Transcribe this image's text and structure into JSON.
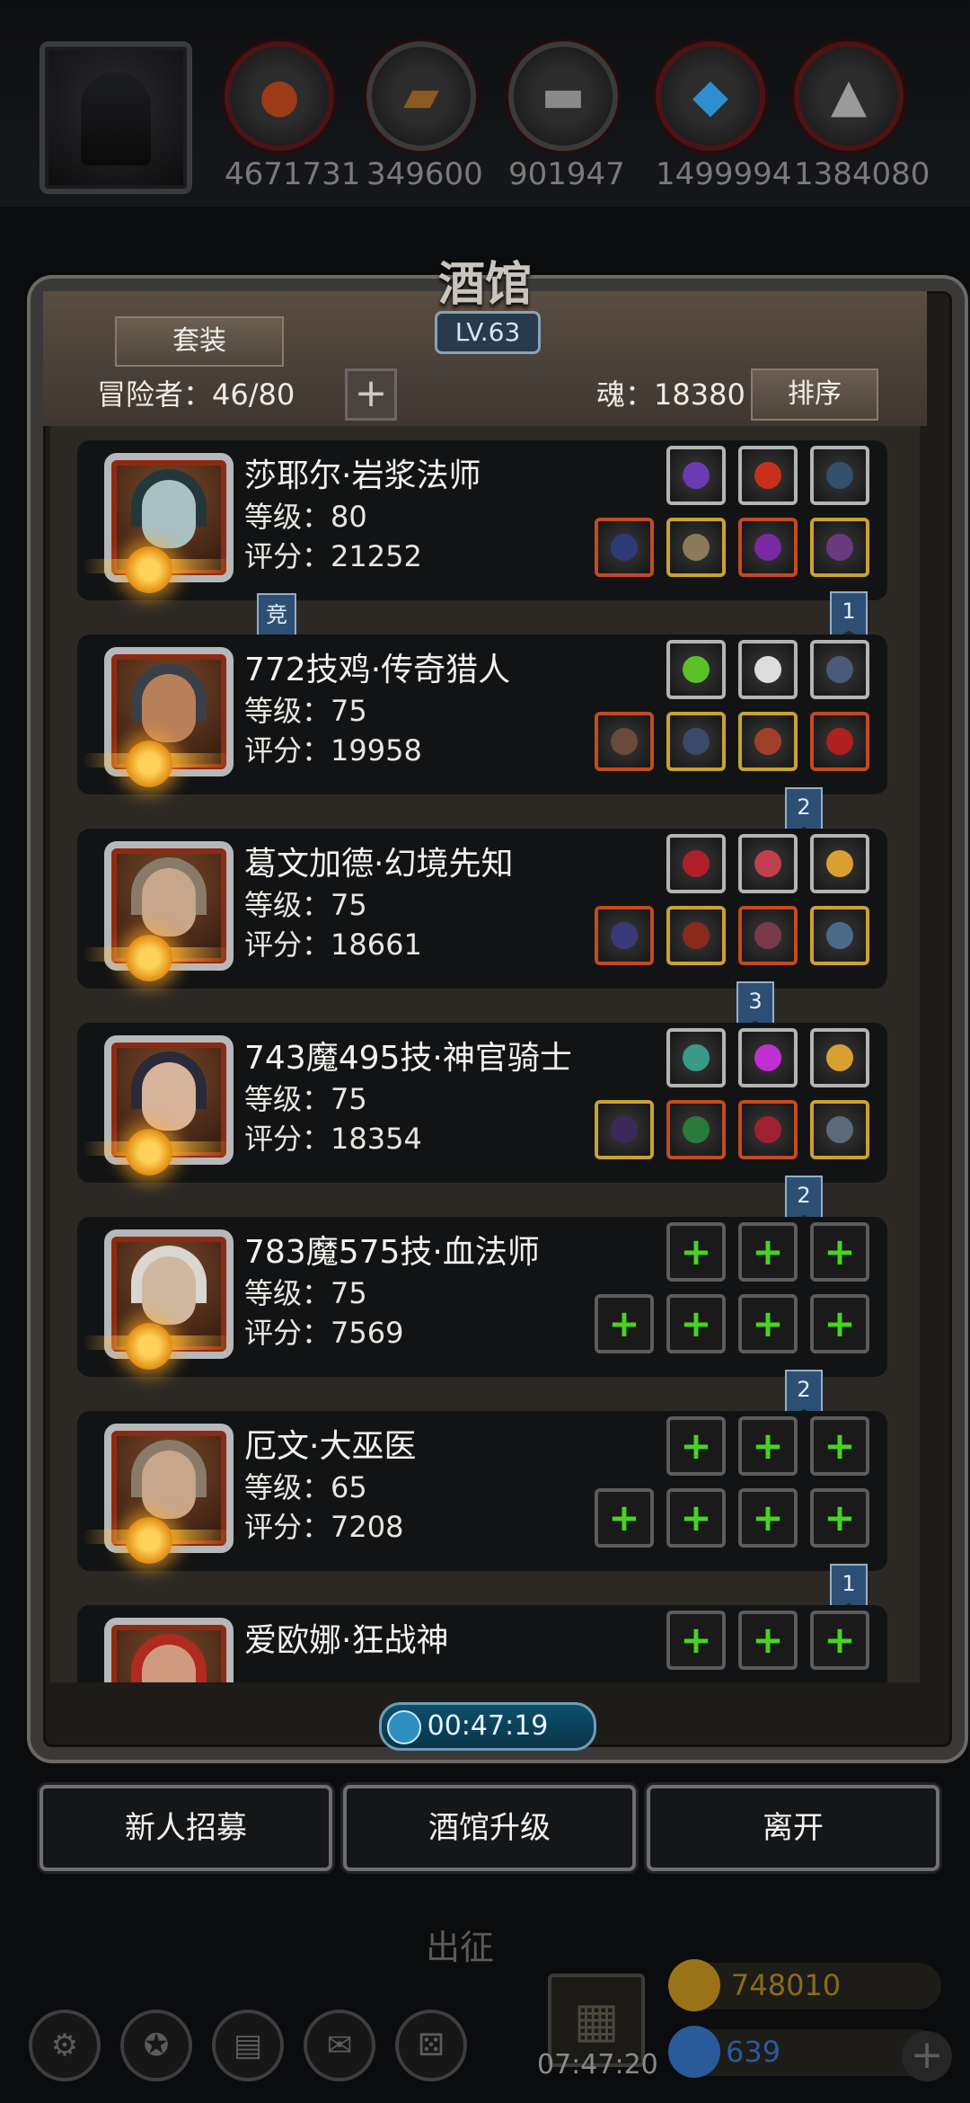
{
  "resources": [
    {
      "icon": "meat-icon",
      "value": "4671731"
    },
    {
      "icon": "wood-icon",
      "value": "349600"
    },
    {
      "icon": "iron-icon",
      "value": "901947"
    },
    {
      "icon": "crystal-icon",
      "value": "1499994"
    },
    {
      "icon": "stone-icon",
      "value": "1384080"
    }
  ],
  "tavern": {
    "title": "酒馆",
    "level": "LV.63",
    "suit_label": "套装",
    "adventurers_label": "冒险者：46/80",
    "soul_label": "魂：18380",
    "sort_label": "排序",
    "competition_badge": "竞"
  },
  "heroes": [
    {
      "name": "莎耶尔·岩浆法师",
      "level": "等级：80",
      "score": "评分：21252",
      "rank": "1",
      "equipped": true
    },
    {
      "name": "772技鸡·传奇猎人",
      "level": "等级：75",
      "score": "评分：19958",
      "rank": "2",
      "equipped": true
    },
    {
      "name": "葛文加德·幻境先知",
      "level": "等级：75",
      "score": "评分：18661",
      "rank": "3",
      "equipped": true
    },
    {
      "name": "743魔495技·神官骑士",
      "level": "等级：75",
      "score": "评分：18354",
      "rank": "2",
      "equipped": true
    },
    {
      "name": "783魔575技·血法师",
      "level": "等级：75",
      "score": "评分：7569",
      "rank": "2",
      "equipped": false
    },
    {
      "name": "厄文·大巫医",
      "level": "等级：65",
      "score": "评分：7208",
      "rank": "1",
      "equipped": false
    },
    {
      "name": "爱欧娜·狂战神",
      "level": "",
      "score": "",
      "rank": "",
      "equipped": false
    }
  ],
  "timer": "00:47:19",
  "actions": {
    "recruit": "新人招募",
    "upgrade": "酒馆升级",
    "leave": "离开"
  },
  "bottom": {
    "expedition": "出征",
    "gift_timer": "07:47:20",
    "gold": "748010",
    "gems": "639",
    "gold_color": "#8a6a1e",
    "gem_color": "#2a5a9a"
  }
}
